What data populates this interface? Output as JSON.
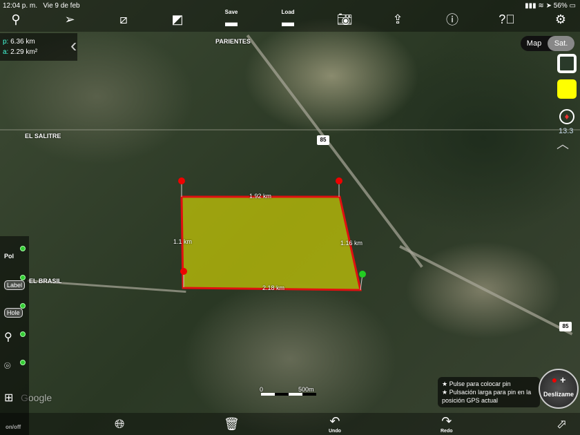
{
  "status": {
    "time": "12:04 p. m.",
    "date": "Vie 9 de feb",
    "battery": "56%"
  },
  "toolbar": {
    "save_label": "Save",
    "load_label": "Load"
  },
  "measure": {
    "perimeter_prefix": "p:",
    "perimeter": "6.36 km",
    "area_prefix": "a:",
    "area": "2.29 km²"
  },
  "map_type": {
    "map": "Map",
    "sat": "Sat."
  },
  "fill_color": "#ffff00",
  "zoom_level": "13.3",
  "map_labels": {
    "parientes": "PARIENTES",
    "salitre": "EL SALITRE",
    "brasil": "EL BRASIL",
    "route1": "85",
    "route2": "85",
    "google": "Google"
  },
  "polygon": {
    "top": "1.92 km",
    "left": "1.1 km",
    "right": "1.16 km",
    "bottom": "2.18 km"
  },
  "scale": {
    "zero": "0",
    "max": "500m"
  },
  "left_tools": {
    "pol": "Pol",
    "label": "Label",
    "hole": "Hole",
    "onoff": "on/off"
  },
  "bottom": {
    "undo": "Undo",
    "redo": "Redo"
  },
  "hint": {
    "line1": "★ Pulse para colocar pin",
    "line2": "★ Pulsación larga para pin en la posición GPS actual"
  },
  "deslizame": "Deslizame"
}
